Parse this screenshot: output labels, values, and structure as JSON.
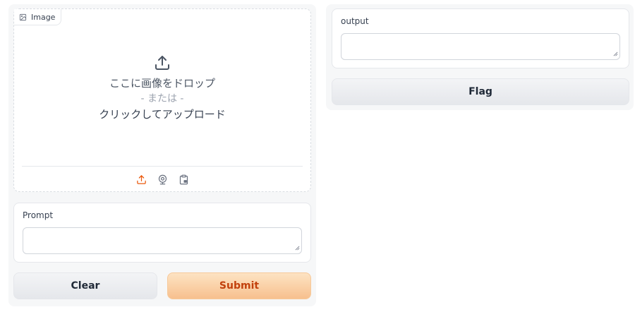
{
  "image_input": {
    "label": "Image",
    "drop_text": "ここに画像をドロップ",
    "or_text": "- または -",
    "click_text": "クリックしてアップロード",
    "sources": [
      "upload-icon",
      "webcam-icon",
      "clipboard-icon"
    ],
    "active_source_color": "#ea580c"
  },
  "prompt": {
    "label": "Prompt",
    "value": "",
    "placeholder": ""
  },
  "buttons": {
    "clear": "Clear",
    "submit": "Submit",
    "flag": "Flag"
  },
  "output": {
    "label": "output",
    "value": ""
  },
  "colors": {
    "primary_text": "#c2410c",
    "primary_bg": "#f7c08e",
    "panel_bg": "#f6f7f8"
  }
}
